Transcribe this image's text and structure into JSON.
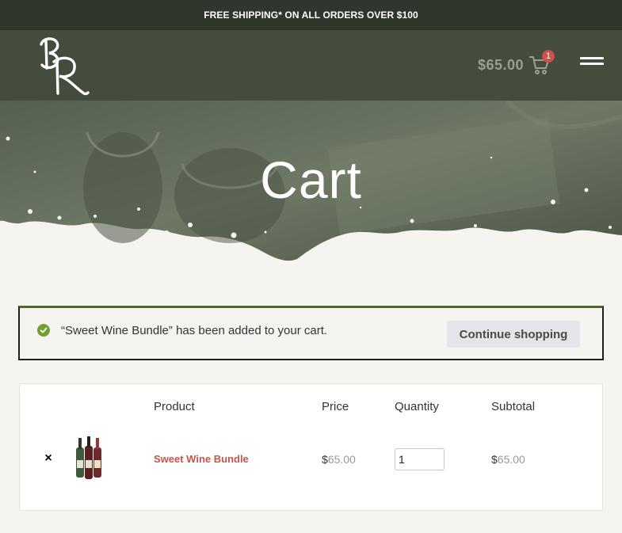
{
  "topbar": {
    "text": "FREE SHIPPING* ON ALL ORDERS OVER $100"
  },
  "header": {
    "logo": "BR",
    "cart_total": "$65.00",
    "cart_count": "1",
    "icons": {
      "cart": "cart-icon",
      "menu": "hamburger-menu-icon"
    }
  },
  "hero": {
    "title": "Cart"
  },
  "notice": {
    "message": "“Sweet Wine Bundle” has been added to your cart.",
    "continue_label": "Continue shopping",
    "accent": "#4c6b28"
  },
  "table": {
    "headers": {
      "product": "Product",
      "price": "Price",
      "quantity": "Quantity",
      "subtotal": "Subtotal"
    },
    "rows": [
      {
        "remove": "×",
        "name": "Sweet Wine Bundle",
        "price_symbol": "$",
        "price_amount": "65.00",
        "quantity": "1",
        "subtotal_symbol": "$",
        "subtotal_amount": "65.00"
      }
    ]
  },
  "colors": {
    "topbar": "#2f372c",
    "header": "#444c3e",
    "link": "#c9524a",
    "badge": "#c9524a",
    "page_bg": "#f6f4f1"
  }
}
